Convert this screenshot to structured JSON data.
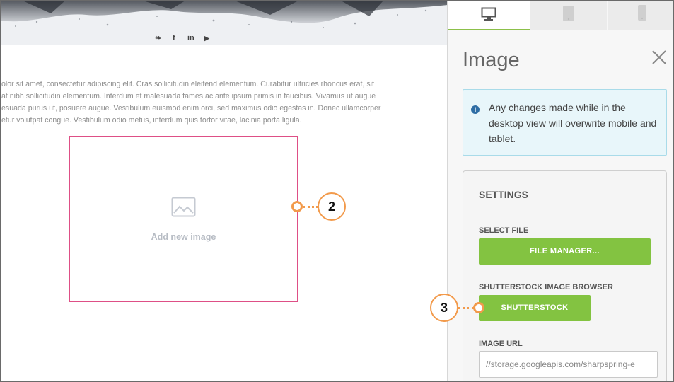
{
  "canvas": {
    "social_icons": [
      "twitter-icon",
      "facebook-icon",
      "linkedin-icon",
      "youtube-icon"
    ],
    "social_glyphs": [
      "❧",
      "f",
      "in",
      "▶"
    ],
    "paragraph_lines": [
      "olor sit amet, consectetur adipiscing elit. Cras sollicitudin eleifend elementum. Curabitur ultricies rhoncus erat, sit",
      "at nibh sollicitudin elementum. Interdum et malesuada fames ac ante ipsum primis in faucibus. Vivamus ut augue",
      "esuada purus ut, posuere augue. Vestibulum euismod enim orci, sed maximus odio egestas in. Donec ullamcorper",
      "etur volutpat congue. Vestibulum odio metus, interdum quis tortor vitae, lacinia porta ligula."
    ],
    "image_placeholder_label": "Add new image"
  },
  "callouts": {
    "two": "2",
    "three": "3"
  },
  "panel": {
    "tabs": [
      "desktop-icon",
      "tablet-icon",
      "mobile-icon"
    ],
    "active_tab": "desktop",
    "title": "Image",
    "info_text": "Any changes made while in the desktop view will overwrite mobile and tablet.",
    "settings_title": "SETTINGS",
    "select_file_label": "SELECT FILE",
    "file_manager_button": "FILE MANAGER...",
    "shutterstock_label": "SHUTTERSTOCK IMAGE BROWSER",
    "shutterstock_button": "SHUTTERSTOCK",
    "image_url_label": "IMAGE URL",
    "image_url_value": "//storage.googleapis.com/sharpspring-e"
  },
  "colors": {
    "accent_green": "#83c341",
    "callout_orange": "#f29a4b",
    "placeholder_border": "#de4f86",
    "info_bg": "#e8f6fa"
  }
}
